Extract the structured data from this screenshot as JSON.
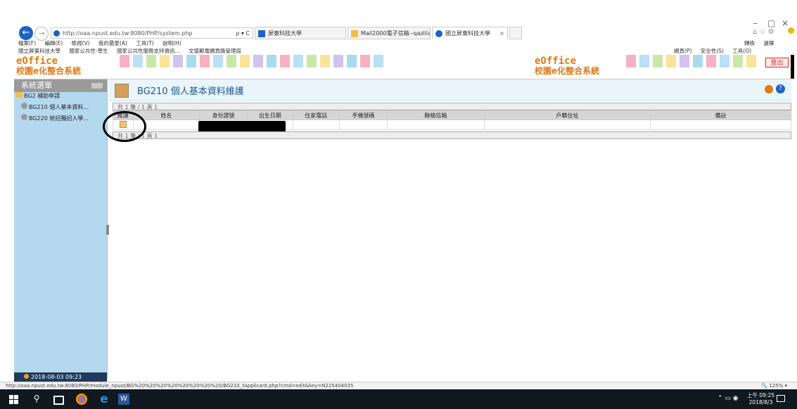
{
  "browser": {
    "address": "http://oaa.npust.edu.tw:8080/PHP/system.php",
    "search_hint": "ρ ▾ C",
    "tabs": [
      {
        "label": "屏東科技大學",
        "active": false
      },
      {
        "label": "Mail2000電子信箱--qazlilan...",
        "active": false
      },
      {
        "label": "國立屏東科技大學",
        "active": true
      }
    ],
    "menu": [
      "檔案(F)",
      "編輯(E)",
      "檢視(V)",
      "我的最愛(A)",
      "工具(T)",
      "說明(H)"
    ],
    "favorites": [
      "國立屏東科技大學",
      "國家公共性-學生",
      "國家公共性服務支持資訊...",
      "文德郵電網頁路管理局"
    ],
    "toolbar_right": [
      "轉換",
      "選擇"
    ],
    "command_bar": [
      "網頁(P)",
      "安全性(S)",
      "工具(O)"
    ]
  },
  "header": {
    "logo_text": "eOffice",
    "logo_sub": "校園e化整合系統",
    "logout_label": "登出"
  },
  "sidebar": {
    "title": "系統選單",
    "group": "BG2 補助申請",
    "items": [
      "BG210 個人基本資料...",
      "BG220 統招獨招入學..."
    ],
    "footer_time": "2018-08-03 09:23"
  },
  "main": {
    "title": "BG210 個人基本資料維護",
    "pager_top": "共 1 筆 / 1 頁 1",
    "pager_bottom": "共 1 筆 / 1 頁 1",
    "columns": [
      "維護",
      "姓名",
      "身份證號",
      "出生日期",
      "住家電話",
      "手機號碼",
      "聯絡信箱",
      "戶籍住址",
      "備註"
    ]
  },
  "status": {
    "url": "http://oaa.npust.edu.tw:8080/PHP/module_npust/BG%20%20%20%20%20%20%20%20/BG210_tApplicant.php?cmd=edit&key=N225404035",
    "zoom": "125%"
  },
  "taskbar": {
    "time": "上午 09:25",
    "date": "2018/8/3"
  },
  "colors": {
    "accent_orange": "#e07a12",
    "sidebar_bg": "#b4d9ef",
    "titlebar_bg": "#eaf4fb",
    "ie_blue": "#1c64c4"
  }
}
